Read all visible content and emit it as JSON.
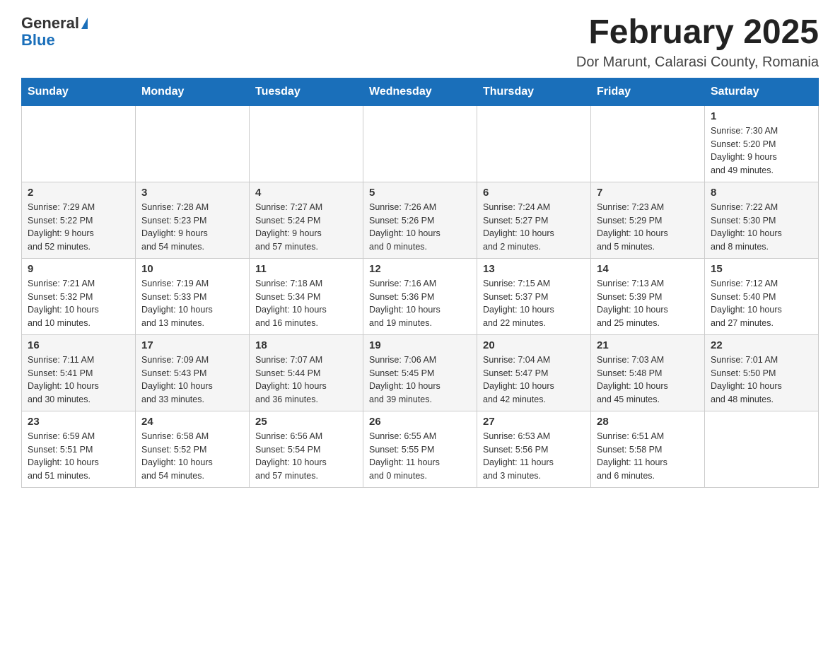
{
  "header": {
    "month_title": "February 2025",
    "location": "Dor Marunt, Calarasi County, Romania",
    "logo_general": "General",
    "logo_blue": "Blue"
  },
  "weekdays": [
    "Sunday",
    "Monday",
    "Tuesday",
    "Wednesday",
    "Thursday",
    "Friday",
    "Saturday"
  ],
  "weeks": [
    [
      {
        "day": "",
        "info": ""
      },
      {
        "day": "",
        "info": ""
      },
      {
        "day": "",
        "info": ""
      },
      {
        "day": "",
        "info": ""
      },
      {
        "day": "",
        "info": ""
      },
      {
        "day": "",
        "info": ""
      },
      {
        "day": "1",
        "info": "Sunrise: 7:30 AM\nSunset: 5:20 PM\nDaylight: 9 hours\nand 49 minutes."
      }
    ],
    [
      {
        "day": "2",
        "info": "Sunrise: 7:29 AM\nSunset: 5:22 PM\nDaylight: 9 hours\nand 52 minutes."
      },
      {
        "day": "3",
        "info": "Sunrise: 7:28 AM\nSunset: 5:23 PM\nDaylight: 9 hours\nand 54 minutes."
      },
      {
        "day": "4",
        "info": "Sunrise: 7:27 AM\nSunset: 5:24 PM\nDaylight: 9 hours\nand 57 minutes."
      },
      {
        "day": "5",
        "info": "Sunrise: 7:26 AM\nSunset: 5:26 PM\nDaylight: 10 hours\nand 0 minutes."
      },
      {
        "day": "6",
        "info": "Sunrise: 7:24 AM\nSunset: 5:27 PM\nDaylight: 10 hours\nand 2 minutes."
      },
      {
        "day": "7",
        "info": "Sunrise: 7:23 AM\nSunset: 5:29 PM\nDaylight: 10 hours\nand 5 minutes."
      },
      {
        "day": "8",
        "info": "Sunrise: 7:22 AM\nSunset: 5:30 PM\nDaylight: 10 hours\nand 8 minutes."
      }
    ],
    [
      {
        "day": "9",
        "info": "Sunrise: 7:21 AM\nSunset: 5:32 PM\nDaylight: 10 hours\nand 10 minutes."
      },
      {
        "day": "10",
        "info": "Sunrise: 7:19 AM\nSunset: 5:33 PM\nDaylight: 10 hours\nand 13 minutes."
      },
      {
        "day": "11",
        "info": "Sunrise: 7:18 AM\nSunset: 5:34 PM\nDaylight: 10 hours\nand 16 minutes."
      },
      {
        "day": "12",
        "info": "Sunrise: 7:16 AM\nSunset: 5:36 PM\nDaylight: 10 hours\nand 19 minutes."
      },
      {
        "day": "13",
        "info": "Sunrise: 7:15 AM\nSunset: 5:37 PM\nDaylight: 10 hours\nand 22 minutes."
      },
      {
        "day": "14",
        "info": "Sunrise: 7:13 AM\nSunset: 5:39 PM\nDaylight: 10 hours\nand 25 minutes."
      },
      {
        "day": "15",
        "info": "Sunrise: 7:12 AM\nSunset: 5:40 PM\nDaylight: 10 hours\nand 27 minutes."
      }
    ],
    [
      {
        "day": "16",
        "info": "Sunrise: 7:11 AM\nSunset: 5:41 PM\nDaylight: 10 hours\nand 30 minutes."
      },
      {
        "day": "17",
        "info": "Sunrise: 7:09 AM\nSunset: 5:43 PM\nDaylight: 10 hours\nand 33 minutes."
      },
      {
        "day": "18",
        "info": "Sunrise: 7:07 AM\nSunset: 5:44 PM\nDaylight: 10 hours\nand 36 minutes."
      },
      {
        "day": "19",
        "info": "Sunrise: 7:06 AM\nSunset: 5:45 PM\nDaylight: 10 hours\nand 39 minutes."
      },
      {
        "day": "20",
        "info": "Sunrise: 7:04 AM\nSunset: 5:47 PM\nDaylight: 10 hours\nand 42 minutes."
      },
      {
        "day": "21",
        "info": "Sunrise: 7:03 AM\nSunset: 5:48 PM\nDaylight: 10 hours\nand 45 minutes."
      },
      {
        "day": "22",
        "info": "Sunrise: 7:01 AM\nSunset: 5:50 PM\nDaylight: 10 hours\nand 48 minutes."
      }
    ],
    [
      {
        "day": "23",
        "info": "Sunrise: 6:59 AM\nSunset: 5:51 PM\nDaylight: 10 hours\nand 51 minutes."
      },
      {
        "day": "24",
        "info": "Sunrise: 6:58 AM\nSunset: 5:52 PM\nDaylight: 10 hours\nand 54 minutes."
      },
      {
        "day": "25",
        "info": "Sunrise: 6:56 AM\nSunset: 5:54 PM\nDaylight: 10 hours\nand 57 minutes."
      },
      {
        "day": "26",
        "info": "Sunrise: 6:55 AM\nSunset: 5:55 PM\nDaylight: 11 hours\nand 0 minutes."
      },
      {
        "day": "27",
        "info": "Sunrise: 6:53 AM\nSunset: 5:56 PM\nDaylight: 11 hours\nand 3 minutes."
      },
      {
        "day": "28",
        "info": "Sunrise: 6:51 AM\nSunset: 5:58 PM\nDaylight: 11 hours\nand 6 minutes."
      },
      {
        "day": "",
        "info": ""
      }
    ]
  ]
}
